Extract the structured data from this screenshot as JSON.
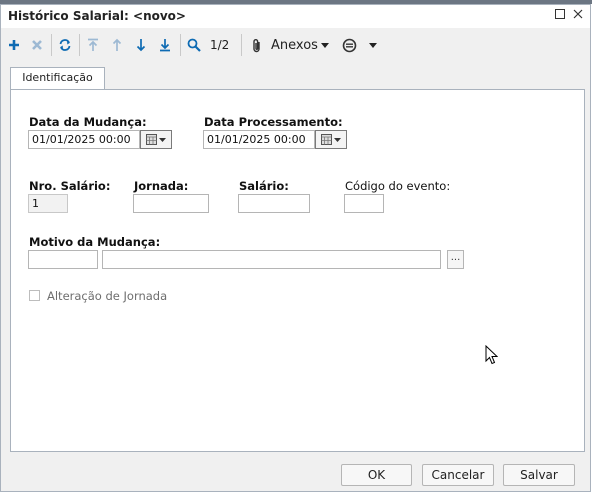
{
  "window": {
    "title": "Histórico Salarial: <novo>"
  },
  "toolbar": {
    "page_indicator": "1/2",
    "anexos_label": "Anexos",
    "icons": [
      "add-icon",
      "delete-icon",
      "refresh-icon",
      "move-first-icon",
      "move-up-icon",
      "move-down-icon",
      "move-last-icon",
      "search-icon",
      "paperclip-icon",
      "chevron-down-icon",
      "options-icon",
      "chevron-down-icon"
    ]
  },
  "tabs": [
    {
      "label": "Identificação",
      "active": true
    }
  ],
  "form": {
    "data_mudanca": {
      "label": "Data da Mudança:",
      "value": "01/01/2025 00:00"
    },
    "data_processamento": {
      "label": "Data Processamento:",
      "value": "01/01/2025 00:00"
    },
    "nro_salario": {
      "label": "Nro. Salário:",
      "value": "1"
    },
    "jornada": {
      "label": "Jornada:",
      "value": ""
    },
    "salario": {
      "label": "Salário:",
      "value": ""
    },
    "codigo_evento": {
      "label": "Código do evento:",
      "value": ""
    },
    "motivo_mudanca": {
      "label": "Motivo da Mudança:",
      "code": "",
      "description": "",
      "lookup_label": "..."
    },
    "alteracao_jornada": {
      "label": "Alteração de Jornada",
      "checked": false
    }
  },
  "buttons": {
    "ok": "OK",
    "cancelar": "Cancelar",
    "salvar": "Salvar"
  },
  "colors": {
    "accent": "#0e6bb3",
    "accent_disabled": "#9db9d3",
    "panel_border": "#a9b2bd",
    "dialog_bg": "#f0f0f0"
  }
}
